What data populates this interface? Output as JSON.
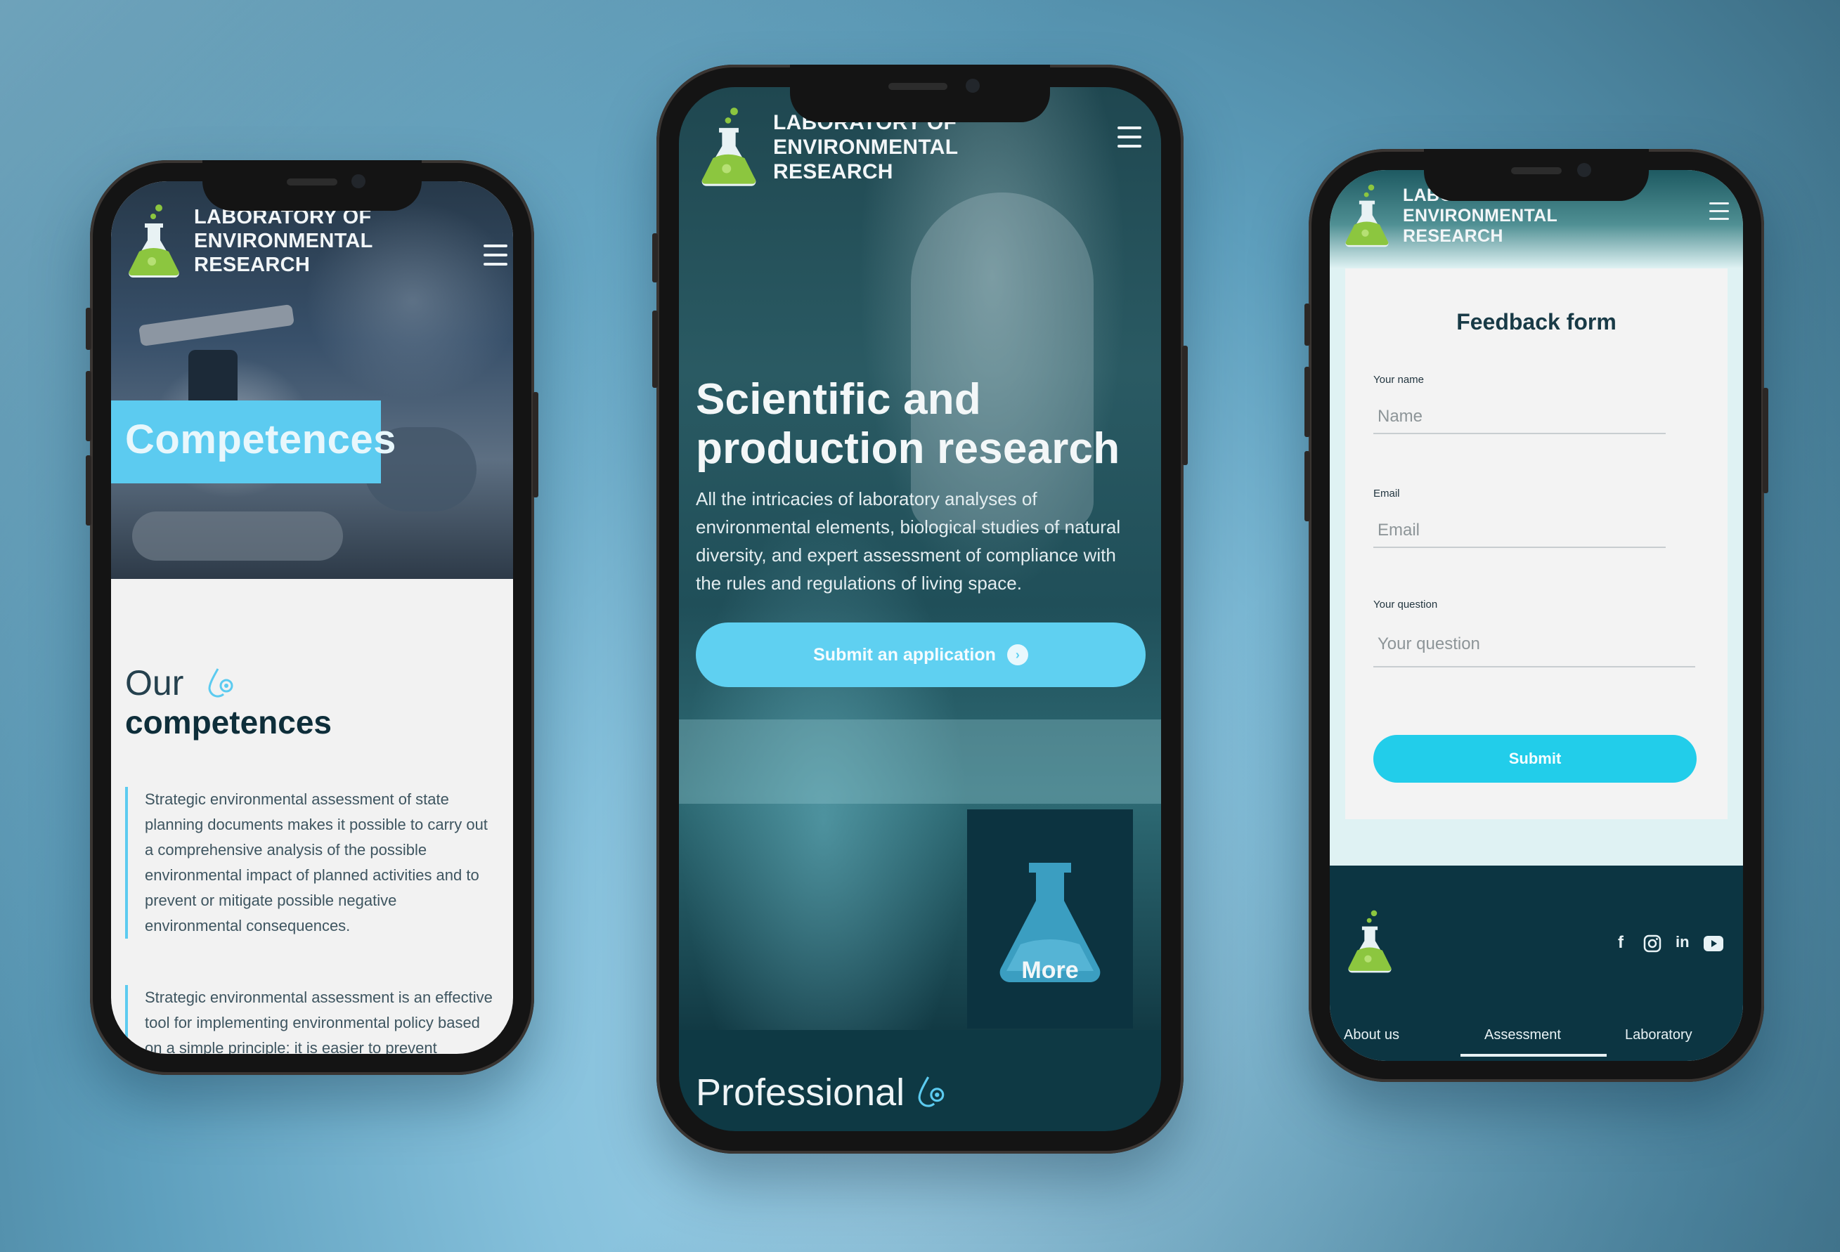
{
  "brand": {
    "line1": "LABORATORY OF",
    "line2": "ENVIRONMENTAL",
    "line3": "RESEARCH"
  },
  "phone1": {
    "banner": "Competences",
    "heading_light": "Our",
    "heading_bold": "competences",
    "paragraphs": [
      "Strategic environmental assessment of state planning documents makes it possible to carry out a comprehensive analysis of the possible environmental impact of planned activities and to prevent or mitigate possible negative environmental consequences.",
      "Strategic environmental assessment is an effective tool for implementing environmental policy based on a simple principle: it is easier to prevent negative"
    ]
  },
  "phone2": {
    "title_line1": "Scientific and",
    "title_line2": "production research",
    "description": "All the intricacies of laboratory analyses of environmental elements, biological studies of natural diversity, and expert assessment of compliance with the rules and regulations of living space.",
    "cta_label": "Submit an application",
    "more_label": "More",
    "section_title": "Professional"
  },
  "phone3": {
    "form_title": "Feedback form",
    "name_label": "Your name",
    "name_placeholder": "Name",
    "email_label": "Email",
    "email_placeholder": "Email",
    "question_label": "Your question",
    "question_placeholder": "Your question",
    "submit_label": "Submit",
    "social": {
      "facebook": "f",
      "linkedin": "in"
    },
    "footer_nav": [
      "About us",
      "Assessment",
      "Laboratory"
    ],
    "active_nav": "Assessment"
  },
  "colors": {
    "accent": "#5ccbf0",
    "dark": "#0c3542",
    "submit": "#22cdea",
    "logo_green": "#8cc63f"
  },
  "icons": [
    "flask-logo-icon",
    "menu-icon",
    "drop-gear-icon",
    "arrow-right-icon",
    "flask-icon",
    "facebook-icon",
    "instagram-icon",
    "linkedin-icon",
    "youtube-icon"
  ]
}
